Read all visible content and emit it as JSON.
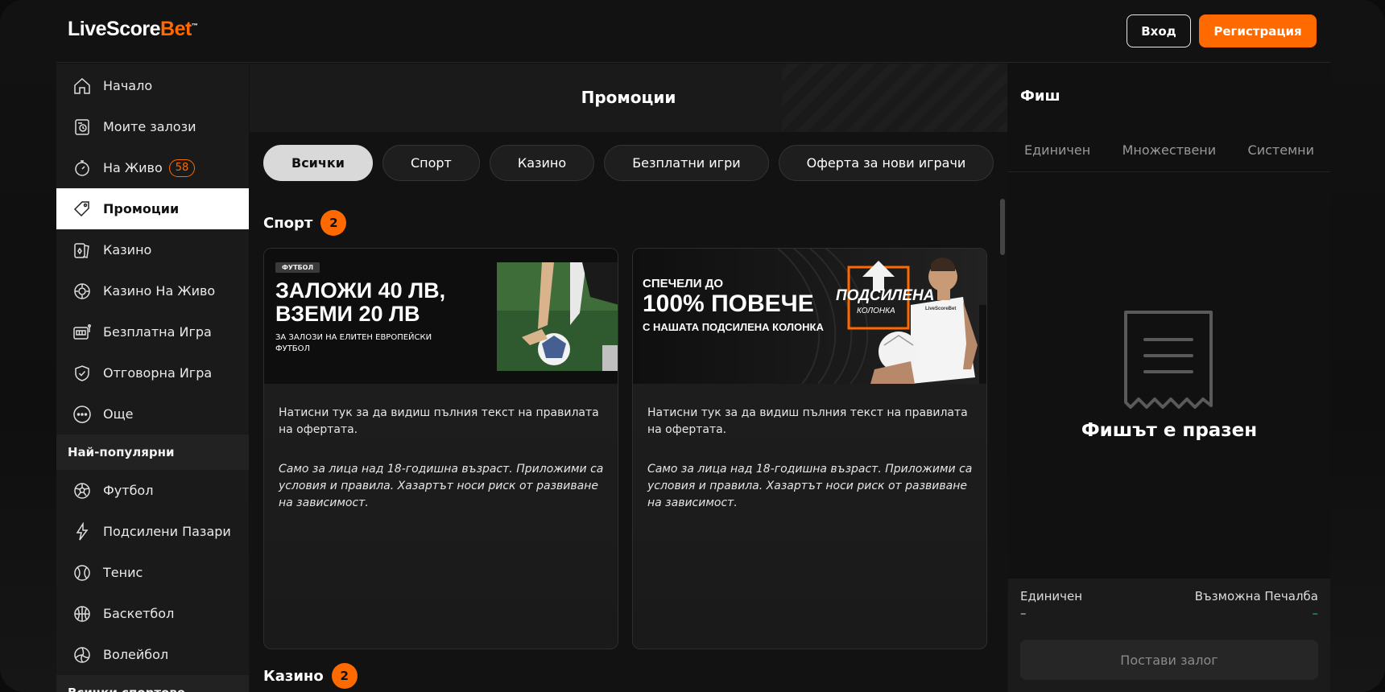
{
  "header": {
    "logo_main": "LiveScore",
    "logo_accent": "Bet",
    "logo_tm": "™",
    "login_label": "Вход",
    "register_label": "Регистрация"
  },
  "sidebar": {
    "items": [
      {
        "label": "Начало",
        "icon": "home-icon"
      },
      {
        "label": "Моите залози",
        "icon": "my-bets-icon"
      },
      {
        "label": "На Живо",
        "icon": "stopwatch-icon",
        "badge": "58"
      },
      {
        "label": "Промоции",
        "icon": "tag-icon",
        "active": true
      },
      {
        "label": "Казино",
        "icon": "cards-icon"
      },
      {
        "label": "Казино На Живо",
        "icon": "chip-icon"
      },
      {
        "label": "Безплатна Игра",
        "icon": "slot-machine-icon"
      },
      {
        "label": "Отговорна Игра",
        "icon": "shield-check-icon"
      },
      {
        "label": "Още",
        "icon": "more-icon"
      }
    ],
    "popular_header": "Най-популярни",
    "popular": [
      {
        "label": "Футбол",
        "icon": "football-icon"
      },
      {
        "label": "Подсилени Пазари",
        "icon": "boost-icon"
      },
      {
        "label": "Тенис",
        "icon": "tennis-icon"
      },
      {
        "label": "Баскетбол",
        "icon": "basketball-icon"
      },
      {
        "label": "Волейбол",
        "icon": "volleyball-icon"
      }
    ],
    "all_sports_header": "Всички спортове"
  },
  "main": {
    "title": "Промоции",
    "chips": [
      {
        "label": "Всички",
        "active": true
      },
      {
        "label": "Спорт"
      },
      {
        "label": "Казино"
      },
      {
        "label": "Безплатни игри"
      },
      {
        "label": "Оферта за нови играчи"
      }
    ],
    "sport_section": {
      "label": "Спорт",
      "count": "2"
    },
    "casino_section": {
      "label": "Казино",
      "count": "2"
    },
    "cards": [
      {
        "banner_tag": "ФУТБОЛ",
        "banner_line1": "ЗАЛОЖИ 40 ЛВ,",
        "banner_line2": "ВЗЕМИ 20 ЛВ",
        "banner_sub1": "ЗА ЗАЛОЗИ НА ЕЛИТЕН ЕВРОПЕЙСКИ",
        "banner_sub2": "ФУТБОЛ",
        "text1": "Натисни тук за да видиш пълния текст на правилата на офертата.",
        "text2": "Само за лица над 18-годишна възраст. Приложими са условия и правила. Хазартът носи риск от развиване на зависимост."
      },
      {
        "banner_line0": "СПЕЧЕЛИ ДО",
        "banner_line1": "100% ПОВЕЧЕ",
        "banner_line2": "С НАШАТА ПОДСИЛЕНА КОЛОНКА",
        "badge_line1": "ПОДСИЛЕНА",
        "badge_line2": "КОЛОНКА",
        "shirt_text": "LiveScoreBet",
        "text1": "Натисни тук за да видиш пълния текст на правилата на офертата.",
        "text2": "Само за лица над 18-годишна възраст. Приложими са условия и правила. Хазартът носи риск от развиване на зависимост."
      }
    ]
  },
  "betslip": {
    "title": "Фиш",
    "tabs": [
      "Единичен",
      "Множествени",
      "Системни"
    ],
    "empty_text": "Фишът е празен",
    "footer_left_label": "Единичен",
    "footer_right_label": "Възможна Печалба",
    "footer_left_value": "–",
    "footer_right_value": "–",
    "place_bet_label": "Постави залог"
  },
  "colors": {
    "accent": "#ff6a00",
    "positive": "#2bb673",
    "background": "#121212"
  }
}
